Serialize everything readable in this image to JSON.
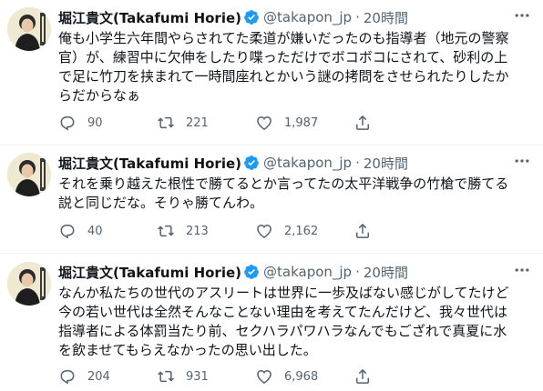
{
  "tweets": [
    {
      "name": "堀江貴文(Takafumi Horie)",
      "handle": "@takapon_jp",
      "dot": "·",
      "time": "20時間",
      "lines": [
        "俺も小学生六年間やらされてた柔道が嫌いだったのも指導者（地元の警察",
        "官）が、練習中に欠伸をしたり喋っただけでボコボコにされて、砂利の上",
        "で足に竹刀を挟まれて一時間座れとかいう謎の拷問をさせられたりしたか",
        "らだからなぁ"
      ],
      "replies": "90",
      "retweets": "221",
      "likes": "1,987"
    },
    {
      "name": "堀江貴文(Takafumi Horie)",
      "handle": "@takapon_jp",
      "dot": "·",
      "time": "20時間",
      "lines": [
        "それを乗り越えた根性で勝てるとか言ってたの太平洋戦争の竹槍で勝てる",
        "説と同じだな。そりゃ勝てんわ。"
      ],
      "replies": "40",
      "retweets": "213",
      "likes": "2,162"
    },
    {
      "name": "堀江貴文(Takafumi Horie)",
      "handle": "@takapon_jp",
      "dot": "·",
      "time": "20時間",
      "lines": [
        "なんか私たちの世代のアスリートは世界に一歩及ばない感じがしてたけど",
        "今の若い世代は全然そんなことない理由を考えてたんだけど、我々世代は",
        "指導者による体罰当たり前、セクハラパワハラなんでもござれで真夏に水",
        "を飲ませてもらえなかったの思い出した。"
      ],
      "replies": "204",
      "retweets": "931",
      "likes": "6,968"
    }
  ],
  "icons": {
    "verified": "verified-badge-icon",
    "more": "more-options-icon",
    "reply": "reply-icon",
    "retweet": "retweet-icon",
    "like": "like-icon",
    "share": "share-icon"
  },
  "colors": {
    "text": "#0f1419",
    "secondary": "#536471",
    "verified": "#1d9bf0",
    "divider": "#eff3f4"
  }
}
